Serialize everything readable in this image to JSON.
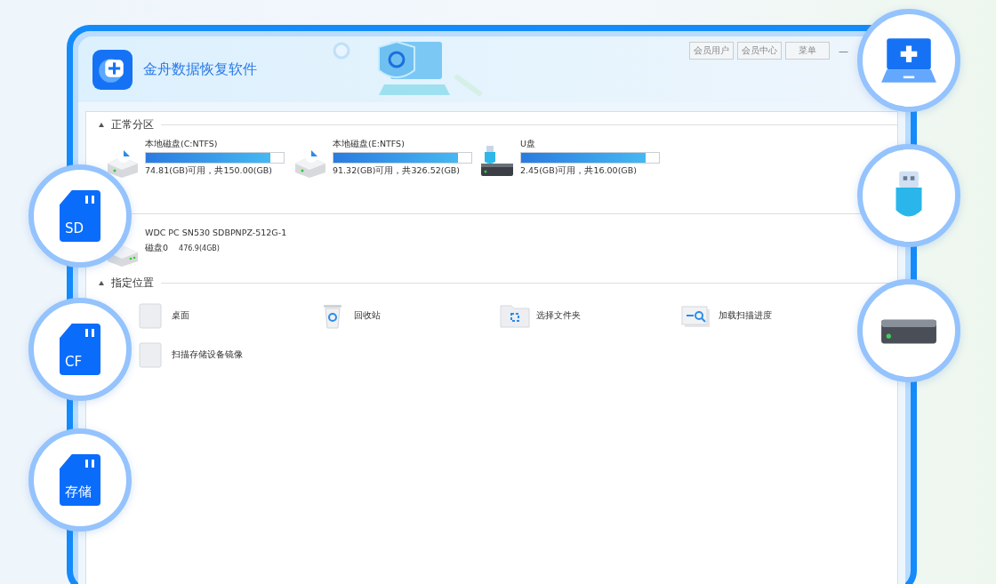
{
  "app": {
    "title": "金舟数据恢复软件",
    "header_buttons": [
      "会员用户",
      "会员中心",
      "菜单"
    ],
    "minimize": "—"
  },
  "sections": [
    {
      "title": "正常分区",
      "kind": "drives",
      "items": [
        {
          "name": "本地磁盘(C:NTFS)",
          "kind": "hdd",
          "level": 0.9,
          "usage": "74.81(GB)可用，共150.00(GB)"
        },
        {
          "name": "本地磁盘(E:NTFS)",
          "kind": "hdd",
          "level": 0.9,
          "usage": "91.32(GB)可用，共326.52(GB)"
        },
        {
          "name": "U盘",
          "kind": "usb",
          "level": 0.9,
          "usage": "2.45(GB)可用，共16.00(GB)"
        }
      ]
    },
    {
      "kind": "disks",
      "items": [
        {
          "name": "WDC PC SN530 SDBPNPZ-512G-1",
          "disk": "磁盘0",
          "size": "476.9(4GB)"
        }
      ]
    },
    {
      "title": "指定位置",
      "kind": "locations",
      "items": [
        {
          "label": "桌面",
          "kind": "desktop"
        },
        {
          "label": "回收站",
          "kind": "recycle"
        },
        {
          "label": "选择文件夹",
          "kind": "folder"
        },
        {
          "label": "加载扫描进度",
          "kind": "progress"
        },
        {
          "label": "扫描存储设备镜像",
          "kind": "image"
        }
      ]
    }
  ],
  "badges": [
    {
      "kind": "card",
      "label": "SD"
    },
    {
      "kind": "card",
      "label": "CF"
    },
    {
      "kind": "card",
      "label": "存储"
    },
    {
      "kind": "laptop"
    },
    {
      "kind": "usb"
    },
    {
      "kind": "hdd"
    }
  ]
}
